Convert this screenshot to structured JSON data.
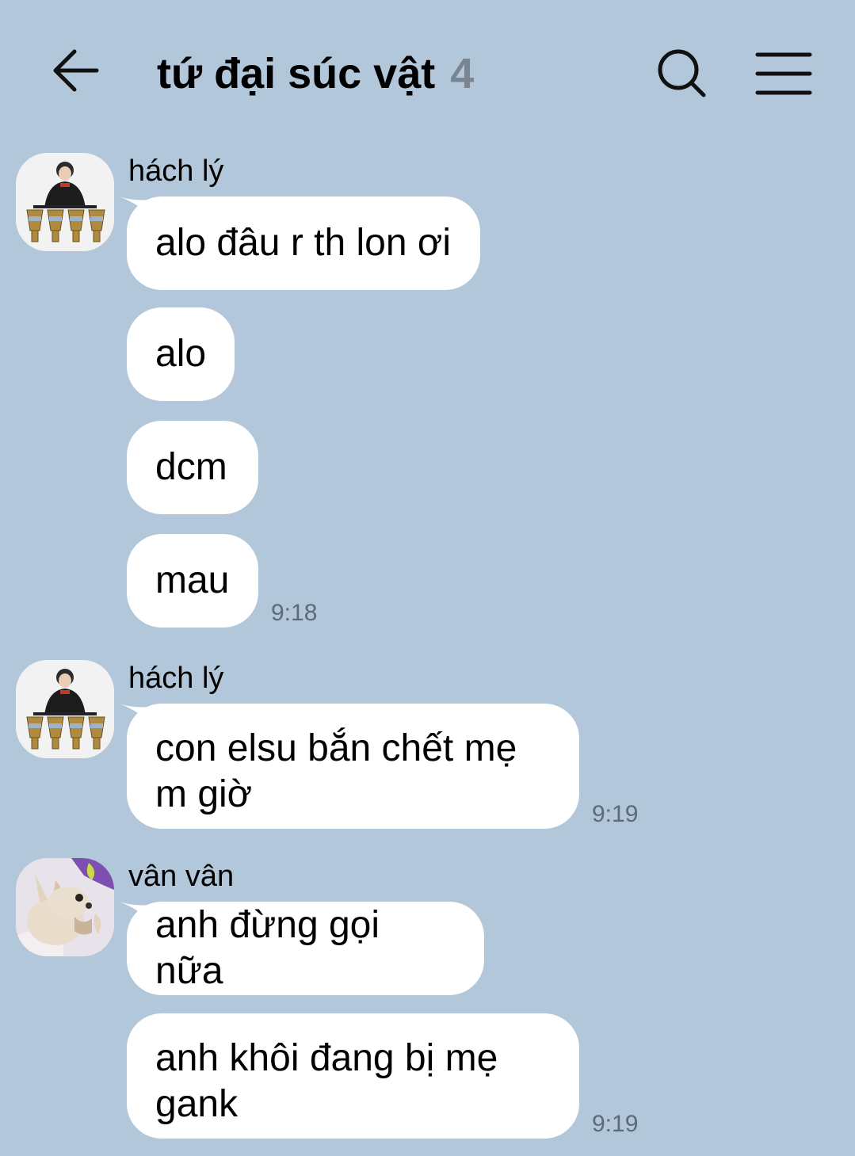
{
  "header": {
    "title": "tứ đại súc vật",
    "member_count": "4"
  },
  "messages": [
    {
      "sender": "hách lý",
      "text": "alo đâu r th lon ơi"
    },
    {
      "text": "alo"
    },
    {
      "text": "dcm"
    },
    {
      "text": "mau",
      "time": "9:18"
    },
    {
      "sender": "hách lý",
      "text_lines": [
        "con elsu bắn chết mẹ",
        "m giờ"
      ],
      "time": "9:19"
    },
    {
      "sender": "vân vân",
      "text": "anh đừng gọi nữa"
    },
    {
      "text_lines": [
        "anh khôi đang bị mẹ",
        "gank"
      ],
      "time": "9:19"
    }
  ],
  "colors": {
    "background": "#b2c7da",
    "bubble": "#ffffff",
    "muted_text": "#5e6a76"
  }
}
